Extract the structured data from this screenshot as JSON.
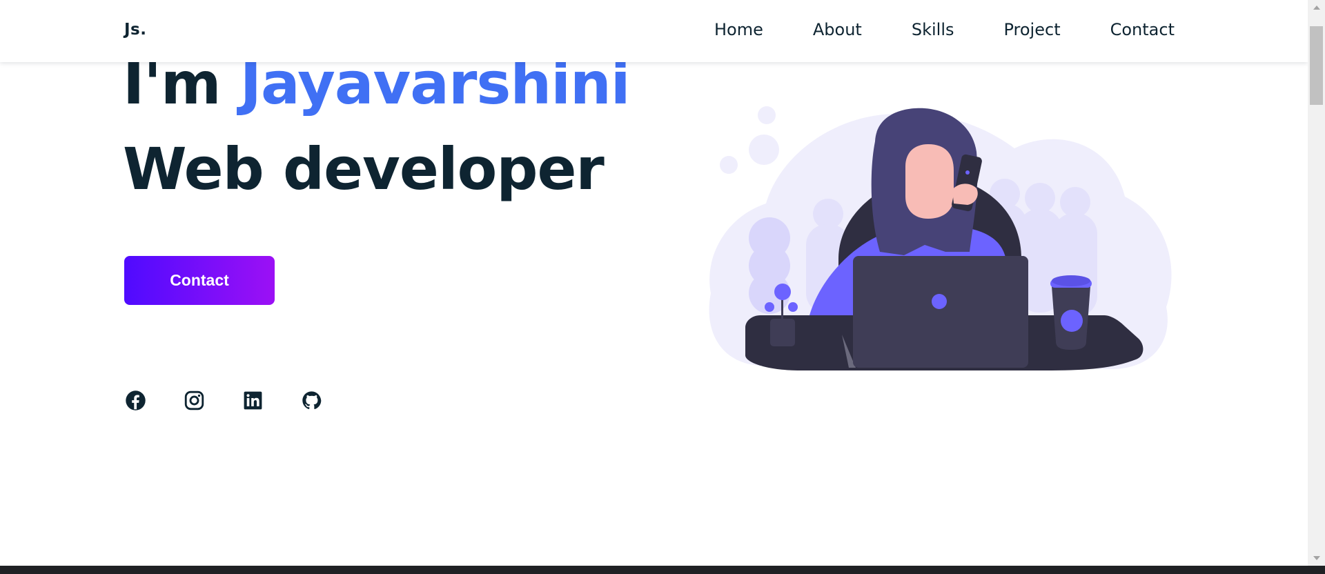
{
  "header": {
    "logo": "Js.",
    "nav": [
      {
        "label": "Home"
      },
      {
        "label": "About"
      },
      {
        "label": "Skills"
      },
      {
        "label": "Project"
      },
      {
        "label": "Contact"
      }
    ]
  },
  "hero": {
    "greeting": "I'm ",
    "name": "Jayavarshini",
    "role": "Web developer",
    "button_label": "Contact"
  },
  "socials": [
    {
      "icon": "facebook-icon"
    },
    {
      "icon": "instagram-icon"
    },
    {
      "icon": "linkedin-icon"
    },
    {
      "icon": "github-icon"
    }
  ],
  "colors": {
    "text": "#0e2431",
    "accent": "#4070f4",
    "button_gradient_start": "#4f0bff",
    "button_gradient_end": "#9c10f5",
    "illustration_purple": "#6c63ff",
    "illustration_dark": "#3f3d56"
  }
}
